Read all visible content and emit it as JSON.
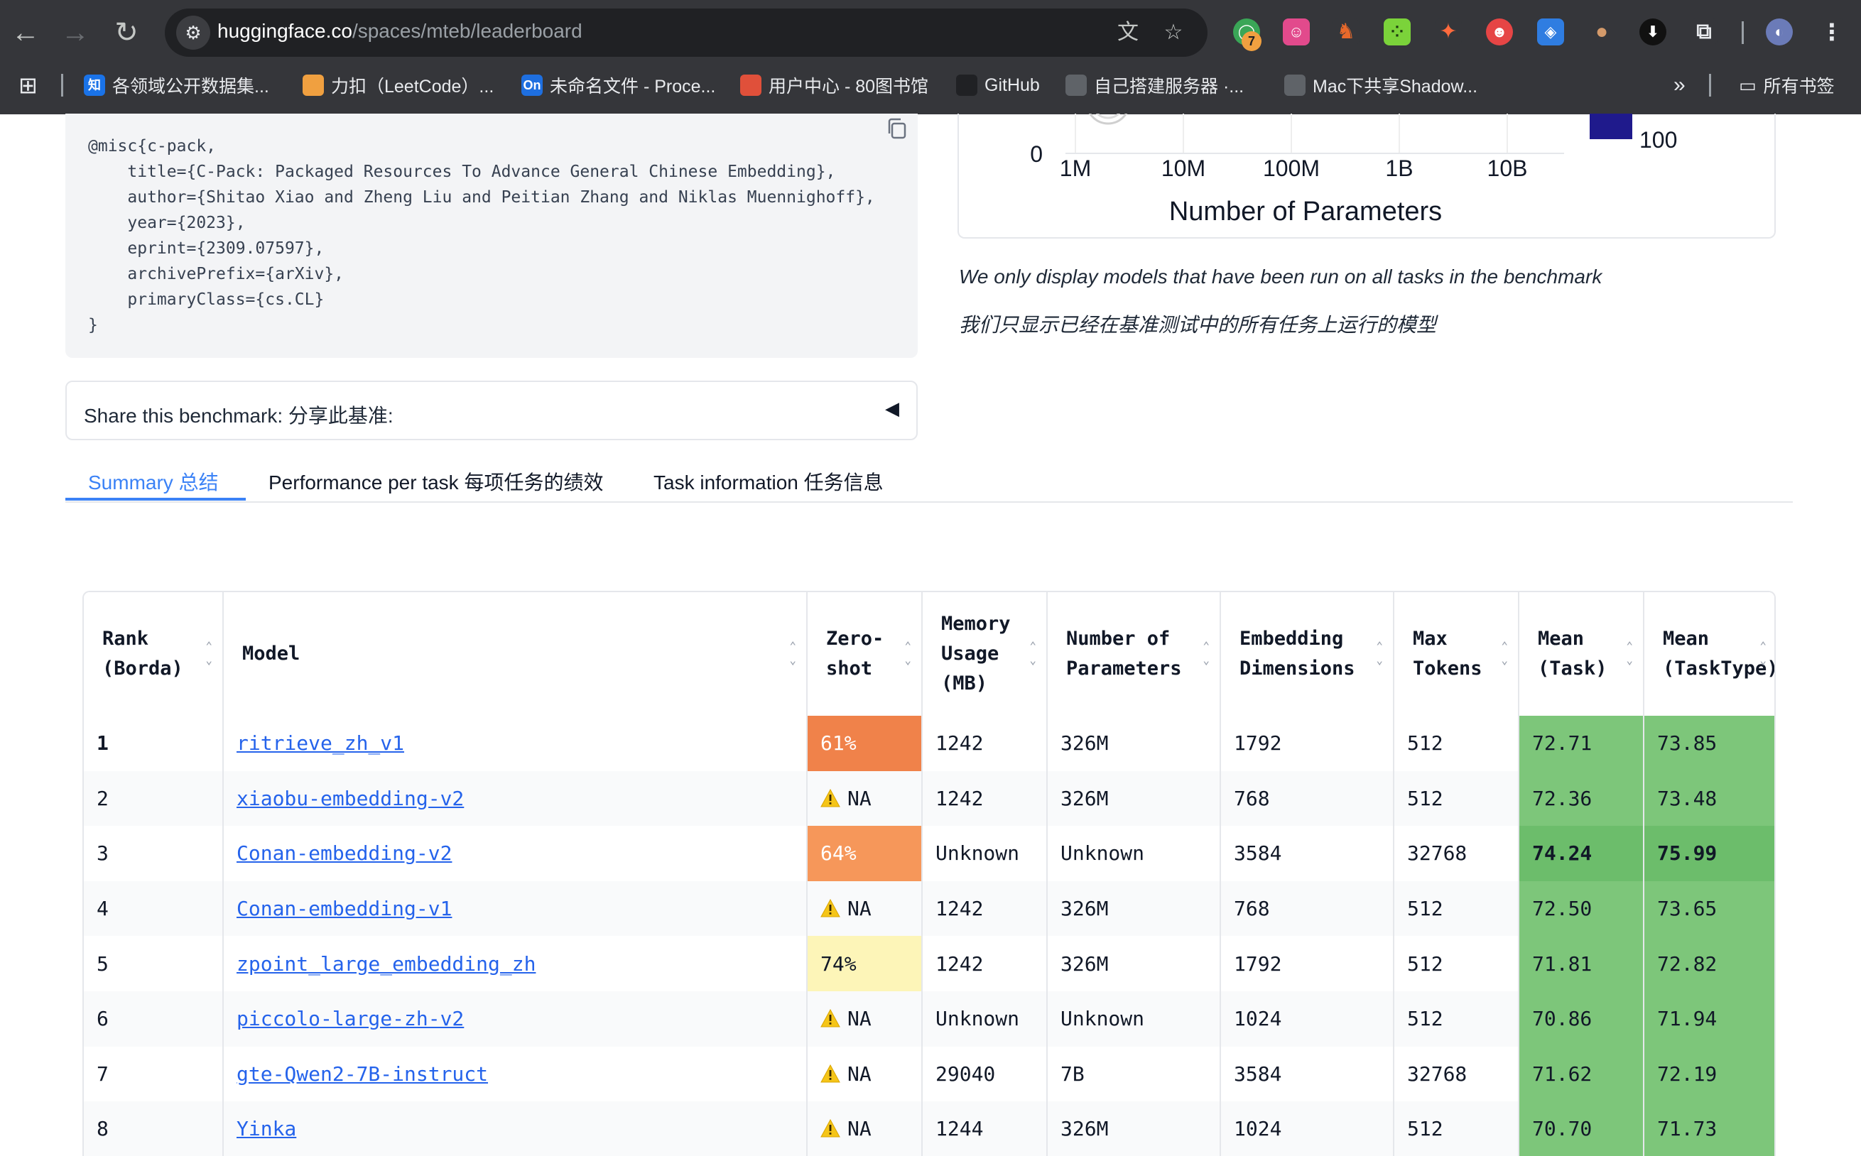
{
  "browser": {
    "url_host": "huggingface.co",
    "url_path": "/spaces/mteb/leaderboard",
    "extension_badge": "7",
    "bookmarks": [
      {
        "icon_text": "知",
        "label": "各领域公开数据集...",
        "color": "#1a73e8"
      },
      {
        "icon_text": "",
        "label": "力扣（LeetCode）...",
        "color": "#f0a040"
      },
      {
        "icon_text": "On",
        "label": "未命名文件 - Proce...",
        "color": "#1e6fe0"
      },
      {
        "icon_text": "",
        "label": "用户中心 - 80图书馆",
        "color": "#e0503a"
      },
      {
        "icon_text": "",
        "label": "GitHub",
        "color": "#202124"
      },
      {
        "icon_text": "",
        "label": "自己搭建服务器 ·...",
        "color": "#5f6368"
      },
      {
        "icon_text": "",
        "label": "Mac下共享Shadow...",
        "color": "#5f6368"
      }
    ],
    "bookmarks_overflow": "»",
    "all_bookmarks": "所有书签"
  },
  "citation": {
    "text": "@misc{c-pack,\n    title={C-Pack: Packaged Resources To Advance General Chinese Embedding},\n    author={Shitao Xiao and Zheng Liu and Peitian Zhang and Niklas Muennighoff},\n    year={2023},\n    eprint={2309.07597},\n    archivePrefix={arXiv},\n    primaryClass={cs.CL}\n}"
  },
  "chart_data": {
    "type": "scatter",
    "title": "",
    "xlabel": "Number of Parameters",
    "ylabel": "",
    "x_scale": "log",
    "x_ticks": [
      "1M",
      "10M",
      "100M",
      "1B",
      "10B"
    ],
    "y_ticks": [
      "0"
    ],
    "colorbar_tick": "100",
    "colorbar_color": "#1f1a8c"
  },
  "notes": {
    "en": "We only display models that have been run on all tasks in the benchmark",
    "zh": "我们只显示已经在基准测试中的所有任务上运行的模型"
  },
  "share": {
    "label": "Share this benchmark:  分享此基准:",
    "caret": "◀"
  },
  "tabs": [
    {
      "label": "Summary  总结"
    },
    {
      "label": "Performance per task  每项任务的绩效"
    },
    {
      "label": "Task information  任务信息"
    }
  ],
  "table": {
    "headers": [
      "Rank\n(Borda)",
      "Model",
      "Zero-\nshot",
      "Memory\nUsage\n(MB)",
      "Number of\nParameters",
      "Embedding\nDimensions",
      "Max\nTokens",
      "Mean\n(Task)",
      "Mean\n(TaskType)"
    ],
    "rows": [
      {
        "rank": "1",
        "model": "ritrieve_zh_v1",
        "zeroshot": "61%",
        "zs_color": "#f0824a",
        "memory": "1242",
        "params": "326M",
        "dims": "1792",
        "tokens": "512",
        "mean_task": "72.71",
        "mean_type": "73.85"
      },
      {
        "rank": "2",
        "model": "xiaobu-embedding-v2",
        "zeroshot": "NA",
        "zs_color": "",
        "memory": "1242",
        "params": "326M",
        "dims": "768",
        "tokens": "512",
        "mean_task": "72.36",
        "mean_type": "73.48"
      },
      {
        "rank": "3",
        "model": "Conan-embedding-v2",
        "zeroshot": "64%",
        "zs_color": "#f6975a",
        "memory": "Unknown",
        "params": "Unknown",
        "dims": "3584",
        "tokens": "32768",
        "mean_task": "74.24",
        "mean_type": "75.99"
      },
      {
        "rank": "4",
        "model": "Conan-embedding-v1",
        "zeroshot": "NA",
        "zs_color": "",
        "memory": "1242",
        "params": "326M",
        "dims": "768",
        "tokens": "512",
        "mean_task": "72.50",
        "mean_type": "73.65"
      },
      {
        "rank": "5",
        "model": "zpoint_large_embedding_zh",
        "zeroshot": "74%",
        "zs_color": "#fdf5b8",
        "memory": "1242",
        "params": "326M",
        "dims": "1792",
        "tokens": "512",
        "mean_task": "71.81",
        "mean_type": "72.82"
      },
      {
        "rank": "6",
        "model": "piccolo-large-zh-v2",
        "zeroshot": "NA",
        "zs_color": "",
        "memory": "Unknown",
        "params": "Unknown",
        "dims": "1024",
        "tokens": "512",
        "mean_task": "70.86",
        "mean_type": "71.94"
      },
      {
        "rank": "7",
        "model": "gte-Qwen2-7B-instruct",
        "zeroshot": "NA",
        "zs_color": "",
        "memory": "29040",
        "params": "7B",
        "dims": "3584",
        "tokens": "32768",
        "mean_task": "71.62",
        "mean_type": "72.19"
      },
      {
        "rank": "8",
        "model": "Yinka",
        "zeroshot": "NA",
        "zs_color": "",
        "memory": "1244",
        "params": "326M",
        "dims": "1024",
        "tokens": "512",
        "mean_task": "70.70",
        "mean_type": "71.73"
      }
    ]
  }
}
